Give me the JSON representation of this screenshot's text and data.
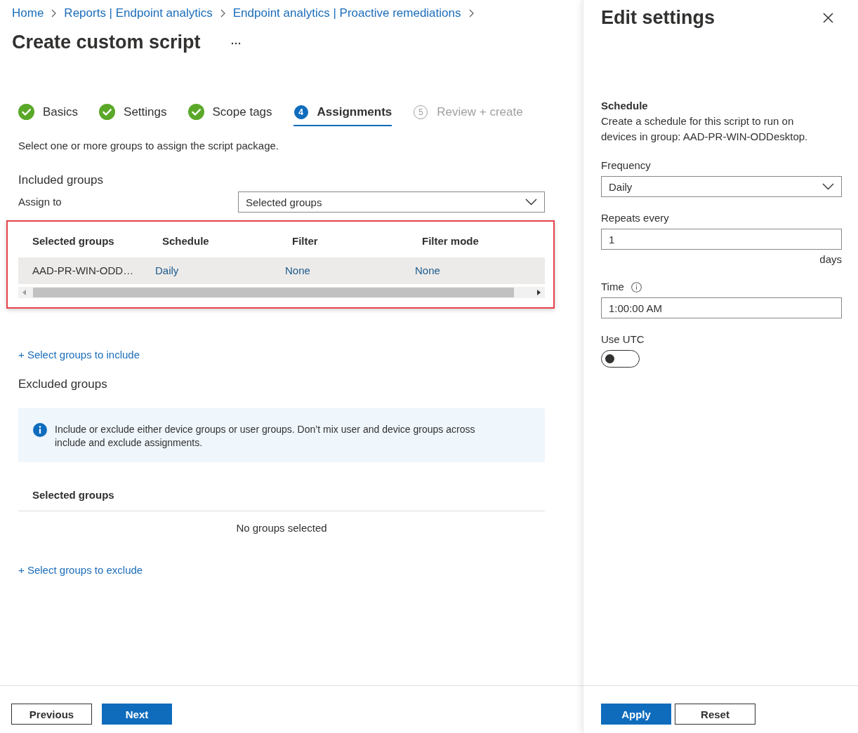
{
  "breadcrumb": [
    {
      "label": "Home"
    },
    {
      "label": "Reports | Endpoint analytics"
    },
    {
      "label": "Endpoint analytics | Proactive remediations"
    }
  ],
  "page": {
    "title": "Create custom script"
  },
  "steps": [
    {
      "label": "Basics",
      "completed": true,
      "selected": false,
      "disabled": false
    },
    {
      "label": "Settings",
      "completed": true,
      "selected": false,
      "disabled": false
    },
    {
      "label": "Scope tags",
      "completed": true,
      "selected": false,
      "disabled": false
    },
    {
      "label": "Assignments",
      "number": "4",
      "completed": false,
      "selected": true,
      "disabled": false
    },
    {
      "label": "Review + create",
      "number": "5",
      "completed": false,
      "selected": false,
      "disabled": true
    }
  ],
  "assignments": {
    "intro": "Select one or more groups to assign the script package.",
    "included": {
      "heading": "Included groups",
      "assign_label": "Assign to",
      "assign_value": "Selected groups",
      "table": {
        "highlighted": true,
        "columns": [
          "Selected groups",
          "Schedule",
          "Filter",
          "Filter mode"
        ],
        "rows": [
          {
            "selected": true,
            "cells": [
              {
                "kind": "text",
                "text": "AAD-PR-WIN-ODD…"
              },
              {
                "kind": "link",
                "text": "Daily"
              },
              {
                "kind": "link",
                "text": "None"
              },
              {
                "kind": "link",
                "text": "None"
              }
            ]
          }
        ]
      },
      "add_link": "+ Select groups to include"
    },
    "excluded": {
      "heading": "Excluded groups",
      "info": "Include or exclude either device groups or user groups. Don’t mix user and device groups across include and exclude assignments.",
      "columns": [
        "Selected groups"
      ],
      "empty_text": "No groups selected",
      "add_link": "+ Select groups to exclude"
    }
  },
  "footer": {
    "buttons": [
      {
        "label": "Previous",
        "kind": "secondary"
      },
      {
        "label": "Next",
        "kind": "primary"
      }
    ]
  },
  "panel": {
    "title": "Edit settings",
    "section_title": "Schedule",
    "description": "Create a schedule for this script to run on devices in group: AAD-PR-WIN-ODDesktop.",
    "fields": [
      {
        "kind": "dropdown",
        "label": "Frequency",
        "value": "Daily"
      },
      {
        "kind": "input",
        "label": "Repeats every",
        "value": "1",
        "suffix": "days"
      },
      {
        "kind": "input",
        "label": "Time",
        "value": "1:00:00 AM",
        "info": true
      },
      {
        "kind": "toggle",
        "label": "Use UTC",
        "on": false
      }
    ],
    "buttons": [
      {
        "label": "Apply",
        "kind": "primary"
      },
      {
        "label": "Reset",
        "kind": "secondary"
      }
    ]
  }
}
